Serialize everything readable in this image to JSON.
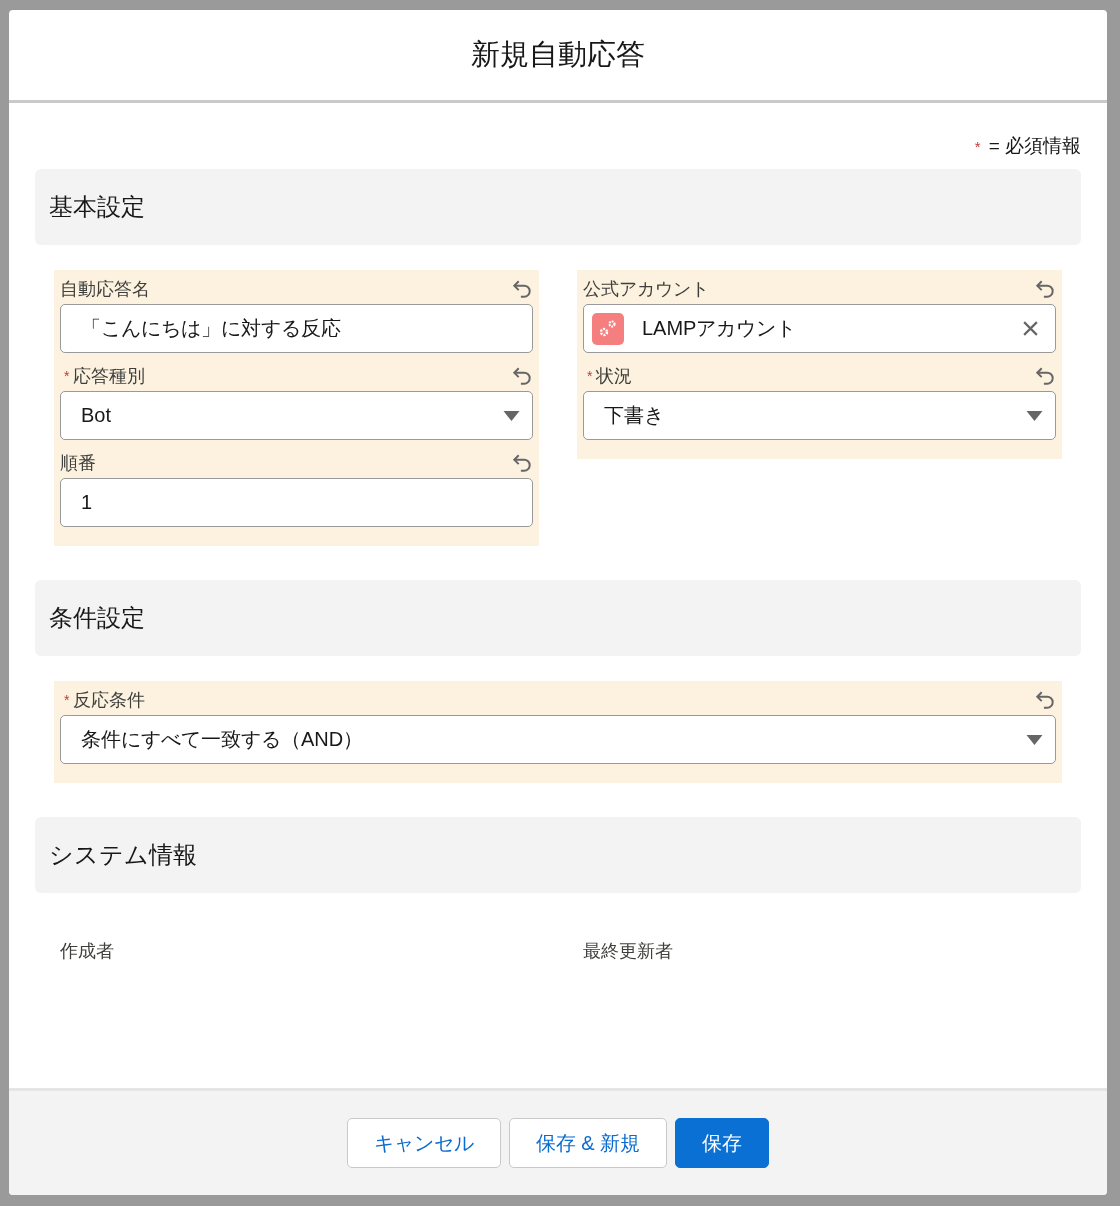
{
  "modal": {
    "title": "新規自動応答",
    "required_note": {
      "mark": "*",
      "text": "= 必須情報"
    },
    "sections": [
      {
        "title": "基本設定",
        "columns": [
          {
            "highlighted": true,
            "fields": [
              {
                "label": "自動応答名",
                "required": false,
                "kind": "text",
                "value": "「こんにちは」に対する反応",
                "undo": true
              },
              {
                "label": "応答種別",
                "required": true,
                "kind": "select",
                "value": "Bot",
                "undo": true
              },
              {
                "label": "順番",
                "required": false,
                "kind": "text",
                "value": "1",
                "undo": true
              }
            ]
          },
          {
            "highlighted": true,
            "fields": [
              {
                "label": "公式アカウント",
                "required": false,
                "kind": "lookup",
                "value": "LAMPアカウント",
                "undo": true
              },
              {
                "label": "状況",
                "required": true,
                "kind": "select",
                "value": "下書き",
                "undo": true
              }
            ]
          }
        ]
      },
      {
        "title": "条件設定",
        "columns": [
          {
            "highlighted": true,
            "fields": [
              {
                "label": "反応条件",
                "required": true,
                "kind": "select",
                "value": "条件にすべて一致する（AND）",
                "undo": true
              }
            ]
          }
        ]
      },
      {
        "title": "システム情報",
        "columns": [
          {
            "fields": [
              {
                "label": "作成者",
                "kind": "readonly"
              }
            ]
          },
          {
            "fields": [
              {
                "label": "最終更新者",
                "kind": "readonly"
              }
            ]
          }
        ]
      }
    ],
    "buttons": [
      {
        "label": "キャンセル",
        "kind": "neutral"
      },
      {
        "label": "保存 & 新規",
        "kind": "neutral"
      },
      {
        "label": "保存",
        "kind": "brand"
      }
    ]
  }
}
